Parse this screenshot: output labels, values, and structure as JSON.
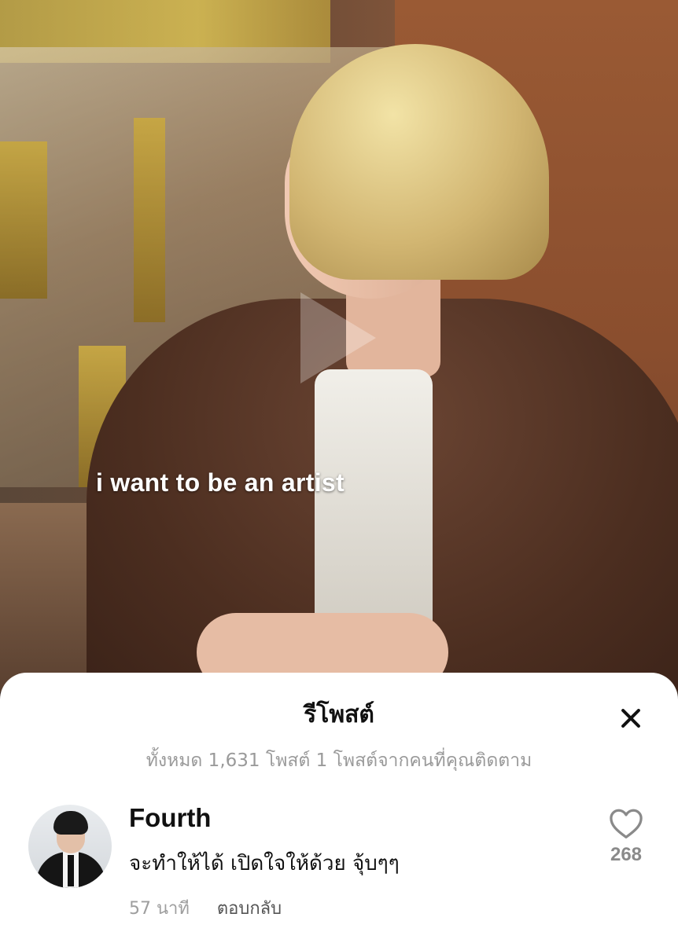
{
  "video": {
    "caption": "i want to be an artist",
    "play_icon": "play-icon"
  },
  "sheet": {
    "title": "รีโพสต์",
    "close_icon": "close-icon",
    "summary": "ทั้งหมด 1,631 โพสต์ 1 โพสต์จากคนที่คุณติดตาม"
  },
  "repost": {
    "username": "Fourth",
    "comment": "จะทำให้ได้ เปิดใจให้ด้วย จุ้บๆๆ",
    "time": "57 นาที",
    "reply_label": "ตอบกลับ",
    "like_icon": "heart-icon",
    "like_count": "268"
  }
}
